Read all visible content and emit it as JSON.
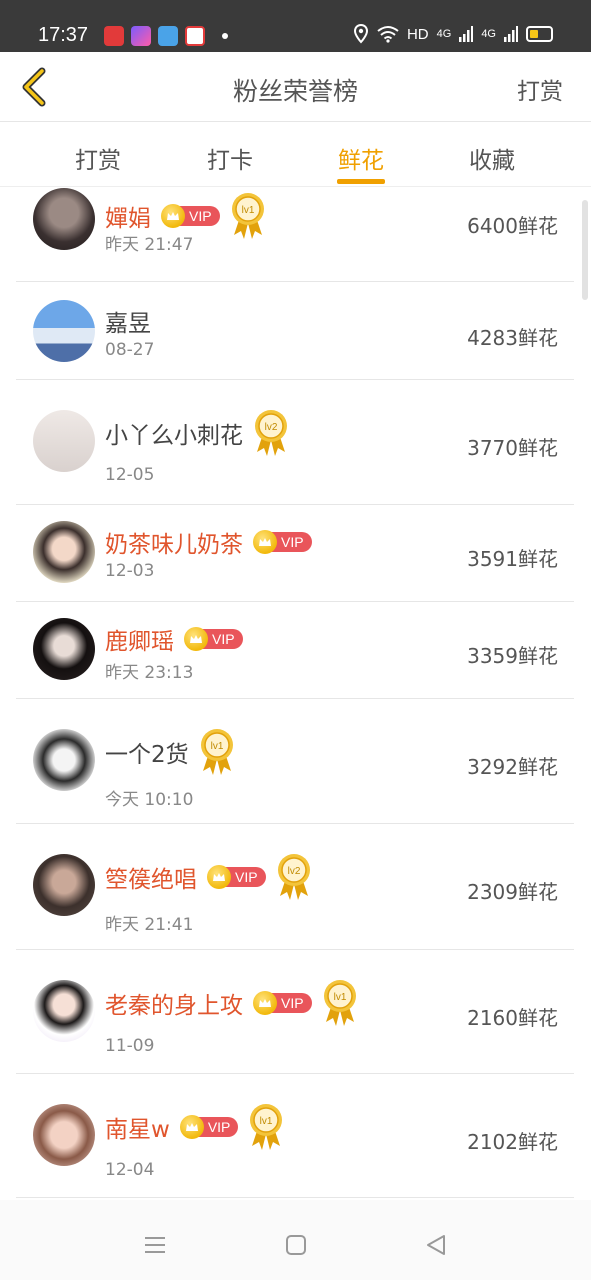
{
  "status_bar": {
    "time": "17:37",
    "network": "HD",
    "signal1": "4G",
    "signal2": "4G",
    "icons": [
      "location-icon",
      "wifi-icon",
      "signal-icon",
      "battery-icon"
    ]
  },
  "header": {
    "title": "粉丝荣誉榜",
    "action": "打赏",
    "back_icon": "chevron-left-icon",
    "accent_color": "#f0a000"
  },
  "tabs": [
    {
      "label": "打赏",
      "active": false
    },
    {
      "label": "打卡",
      "active": false
    },
    {
      "label": "鲜花",
      "active": true
    },
    {
      "label": "收藏",
      "active": false
    }
  ],
  "fans": [
    {
      "name": "嬋娟",
      "vip": true,
      "level": "lv1",
      "date": "昨天 21:47",
      "amount": "6400鲜花"
    },
    {
      "name": "嘉昱",
      "vip": false,
      "level": "",
      "date": "08-27",
      "amount": "4283鲜花"
    },
    {
      "name": "小丫么小刺花",
      "vip": false,
      "level": "lv2",
      "date": "12-05",
      "amount": "3770鲜花"
    },
    {
      "name": "奶茶味儿奶茶",
      "vip": true,
      "level": "",
      "date": "12-03",
      "amount": "3591鲜花"
    },
    {
      "name": "鹿卿瑶",
      "vip": true,
      "level": "",
      "date": "昨天 23:13",
      "amount": "3359鲜花"
    },
    {
      "name": "一个2货",
      "vip": false,
      "level": "lv1",
      "date": "今天 10:10",
      "amount": "3292鲜花"
    },
    {
      "name": "箜篌绝唱",
      "vip": true,
      "level": "lv2",
      "date": "昨天 21:41",
      "amount": "2309鲜花"
    },
    {
      "name": "老秦的身上攻",
      "vip": true,
      "level": "lv1",
      "date": "11-09",
      "amount": "2160鲜花"
    },
    {
      "name": "南星w",
      "vip": true,
      "level": "lv1",
      "date": "12-04",
      "amount": "2102鲜花"
    }
  ],
  "vip_label": "VIP",
  "nav": [
    "menu-icon",
    "home-square-icon",
    "back-triangle-icon"
  ]
}
